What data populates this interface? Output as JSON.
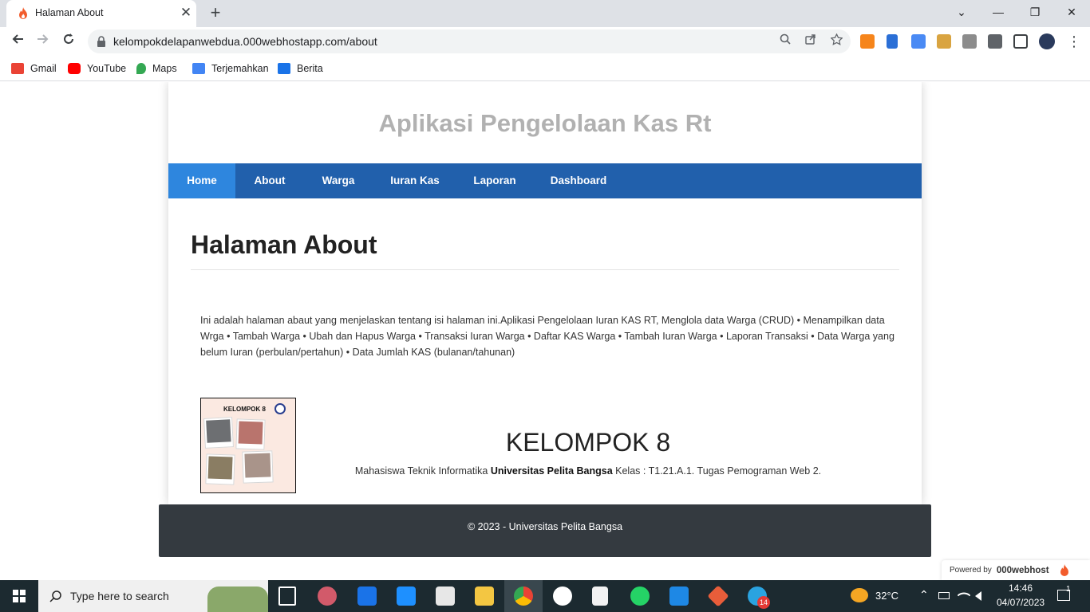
{
  "browser": {
    "tab_title": "Halaman About",
    "tab_close": "✕",
    "new_tab": "+",
    "url": "kelompokdelapanwebdua.000webhostapp.com/about",
    "window_buttons": [
      "⌄",
      "—",
      "❐",
      "✕"
    ],
    "bookmarks": [
      {
        "label": "Gmail",
        "icon": "gmail-icon",
        "color": "#ea4335"
      },
      {
        "label": "YouTube",
        "icon": "youtube-icon",
        "color": "#ff0000"
      },
      {
        "label": "Maps",
        "icon": "maps-icon",
        "color": "#34a853"
      },
      {
        "label": "Terjemahkan",
        "icon": "translate-icon",
        "color": "#4285f4"
      },
      {
        "label": "Berita",
        "icon": "news-icon",
        "color": "#1a73e8"
      }
    ]
  },
  "site": {
    "title": "Aplikasi Pengelolaan Kas Rt",
    "nav": [
      "Home",
      "About",
      "Warga",
      "Iuran Kas",
      "Laporan",
      "Dashboard"
    ],
    "active_nav": "Home",
    "page_heading": "Halaman About",
    "description": "Ini adalah halaman abaut yang menjelaskan tentang isi halaman ini.Aplikasi Pengelolaan Iuran KAS RT, Menglola data Warga (CRUD) • Menampilkan data Wrga • Tambah Warga • Ubah dan Hapus Warga • Transaksi Iuran Warga • Daftar KAS Warga • Tambah Iuran Warga • Laporan Transaksi • Data Warga yang belum Iuran (perbulan/pertahun) • Data Jumlah KAS (bulanan/tahunan)",
    "group_image_label": "KELOMPOK 8",
    "group_name": "KELOMPOK 8",
    "group_desc_prefix": "Mahasiswa Teknik Informatika ",
    "group_desc_university": "Universitas Pelita Bangsa",
    "group_desc_suffix": " Kelas : T1.21.A.1. Tugas Pemograman Web 2.",
    "footer": "© 2023 - Universitas Pelita Bangsa",
    "powered_by": "Powered by",
    "host_name": "000webhost"
  },
  "colors": {
    "navbar": "#2160ac",
    "nav_active": "#2e86de",
    "footer": "#343a40",
    "title_grey": "#b1b1b1"
  },
  "taskbar": {
    "search_placeholder": "Type here to search",
    "temperature": "32°C",
    "time": "14:46",
    "date": "04/07/2023",
    "notification_count": "1",
    "telegram_badge": "14"
  }
}
